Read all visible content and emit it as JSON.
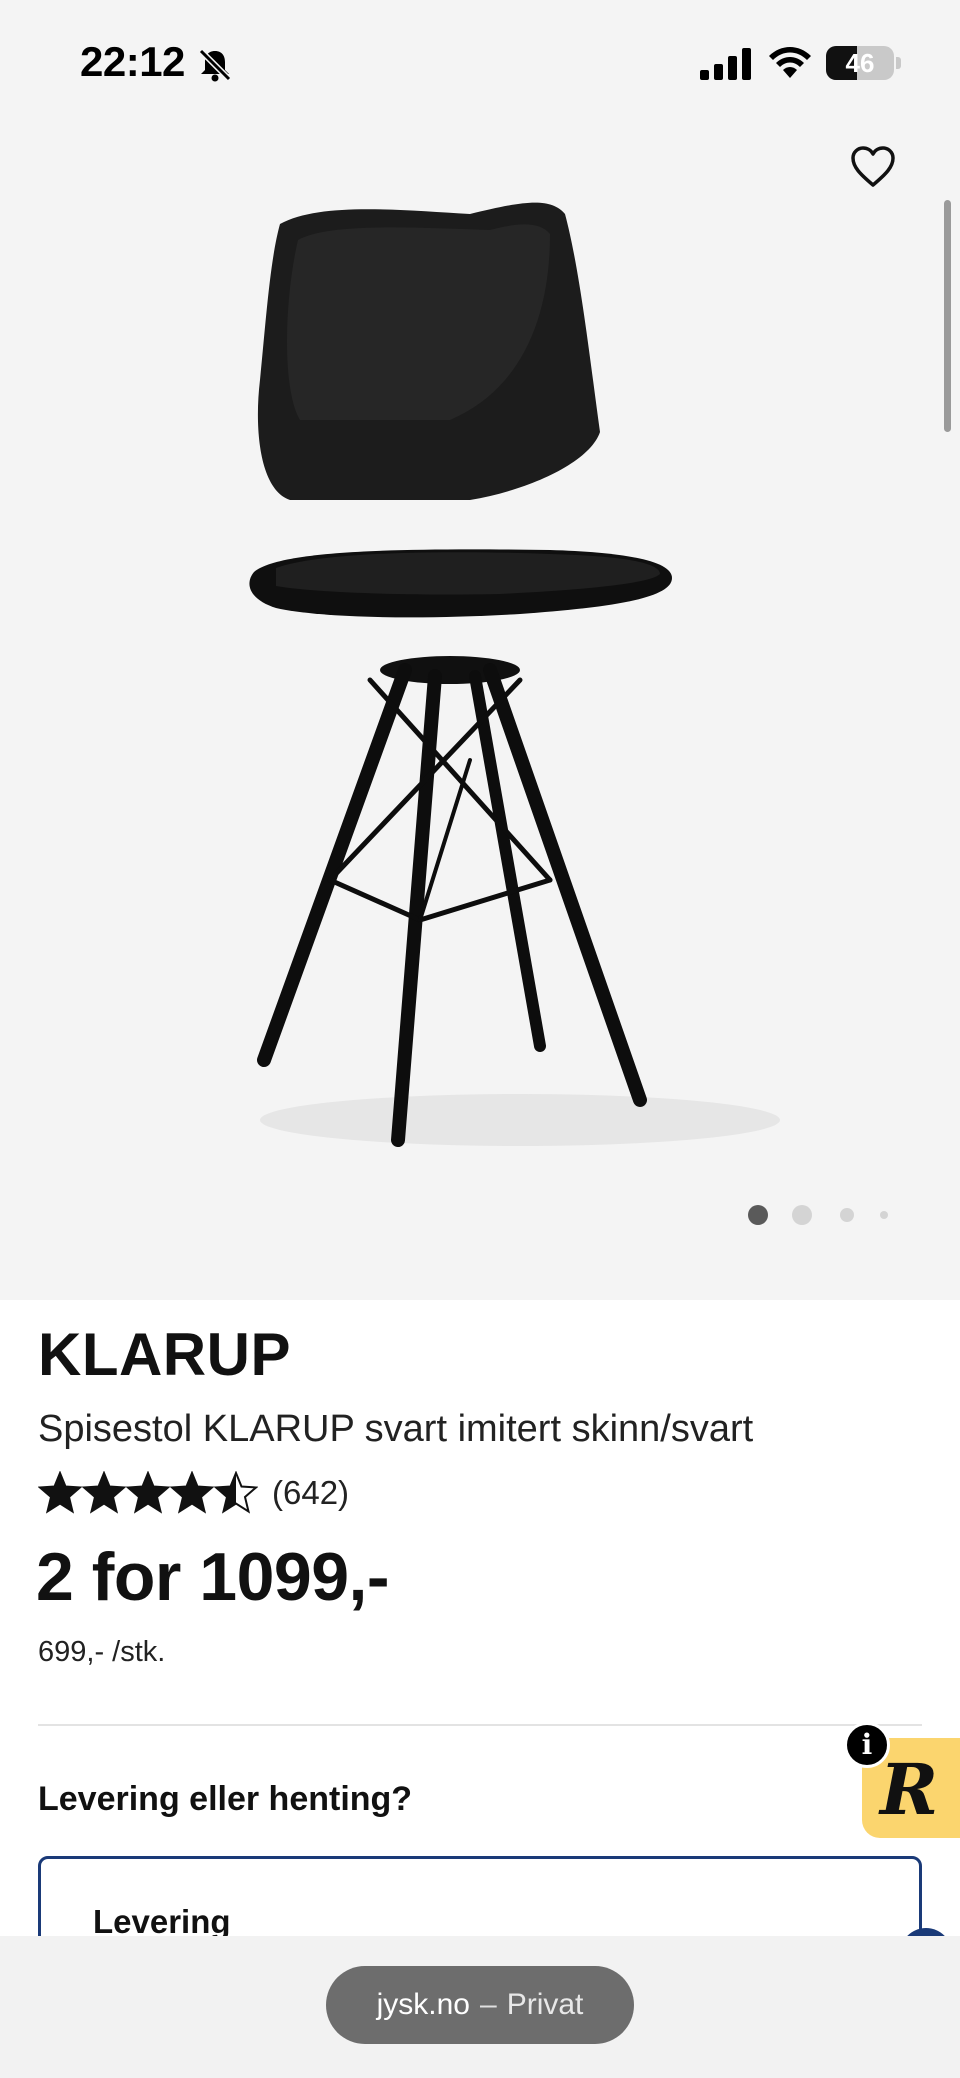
{
  "status_bar": {
    "time": "22:12",
    "battery_level": "46",
    "battery_fraction": 0.46
  },
  "icons": {
    "bell": "bell-slash-icon",
    "signal": "cellular-signal-icon",
    "wifi": "wifi-icon",
    "favorite": "heart-outline-icon",
    "info": "info-icon"
  },
  "carousel": {
    "total_images": 4,
    "active_index": 0
  },
  "product": {
    "title": "KLARUP",
    "subtitle": "Spisestol KLARUP svart imitert skinn/svart",
    "rating": 4.5,
    "rating_max": 5,
    "review_count": "(642)",
    "price_main": "2 for 1099,-",
    "price_unit": "699,- /stk."
  },
  "delivery": {
    "heading": "Levering eller henting?",
    "option_label": "Levering"
  },
  "widget": {
    "info_glyph": "i",
    "letter": "R"
  },
  "browser": {
    "domain": "jysk.no",
    "separator": "–",
    "mode": "Privat"
  },
  "colors": {
    "background": "#f4f4f4",
    "accent_border": "#1a3a78",
    "widget_yellow": "#fbd56e",
    "url_pill": "#6d6d6d"
  }
}
